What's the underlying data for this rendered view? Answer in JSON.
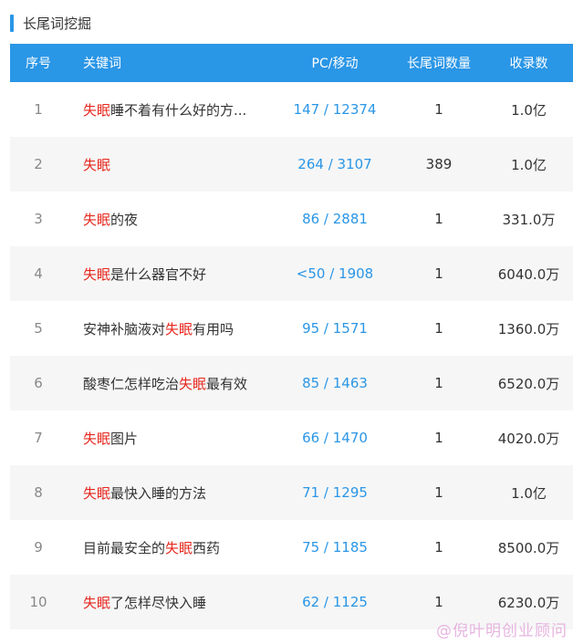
{
  "section": {
    "title": "长尾词挖掘"
  },
  "table": {
    "headers": {
      "index": "序号",
      "keyword": "关键词",
      "pc_mobile": "PC/移动",
      "longtail": "长尾词数量",
      "indexed": "收录数"
    },
    "rows": [
      {
        "index": "1",
        "kw_pre": "",
        "kw_hl": "失眠",
        "kw_post": "睡不着有什么好的方...",
        "pc_mobile": "147 / 12374",
        "longtail": "1",
        "indexed": "1.0亿"
      },
      {
        "index": "2",
        "kw_pre": "",
        "kw_hl": "失眠",
        "kw_post": "",
        "pc_mobile": "264 / 3107",
        "longtail": "389",
        "indexed": "1.0亿"
      },
      {
        "index": "3",
        "kw_pre": "",
        "kw_hl": "失眠",
        "kw_post": "的夜",
        "pc_mobile": "86 / 2881",
        "longtail": "1",
        "indexed": "331.0万"
      },
      {
        "index": "4",
        "kw_pre": "",
        "kw_hl": "失眠",
        "kw_post": "是什么器官不好",
        "pc_mobile": "<50 / 1908",
        "longtail": "1",
        "indexed": "6040.0万"
      },
      {
        "index": "5",
        "kw_pre": "安神补脑液对",
        "kw_hl": "失眠",
        "kw_post": "有用吗",
        "pc_mobile": "95 / 1571",
        "longtail": "1",
        "indexed": "1360.0万"
      },
      {
        "index": "6",
        "kw_pre": "酸枣仁怎样吃治",
        "kw_hl": "失眠",
        "kw_post": "最有效",
        "pc_mobile": "85 / 1463",
        "longtail": "1",
        "indexed": "6520.0万"
      },
      {
        "index": "7",
        "kw_pre": "",
        "kw_hl": "失眠",
        "kw_post": "图片",
        "pc_mobile": "66 / 1470",
        "longtail": "1",
        "indexed": "4020.0万"
      },
      {
        "index": "8",
        "kw_pre": "",
        "kw_hl": "失眠",
        "kw_post": "最快入睡的方法",
        "pc_mobile": "71 / 1295",
        "longtail": "1",
        "indexed": "1.0亿"
      },
      {
        "index": "9",
        "kw_pre": "目前最安全的",
        "kw_hl": "失眠",
        "kw_post": "西药",
        "pc_mobile": "75 / 1185",
        "longtail": "1",
        "indexed": "8500.0万"
      },
      {
        "index": "10",
        "kw_pre": "",
        "kw_hl": "失眠",
        "kw_post": "了怎样尽快入睡",
        "pc_mobile": "62 / 1125",
        "longtail": "1",
        "indexed": "6230.0万"
      }
    ]
  },
  "watermark": "@倪叶明创业顾问",
  "colors": {
    "accent": "#2a96e6",
    "highlight": "#e6281e",
    "alt_row": "#f6f6f6"
  }
}
